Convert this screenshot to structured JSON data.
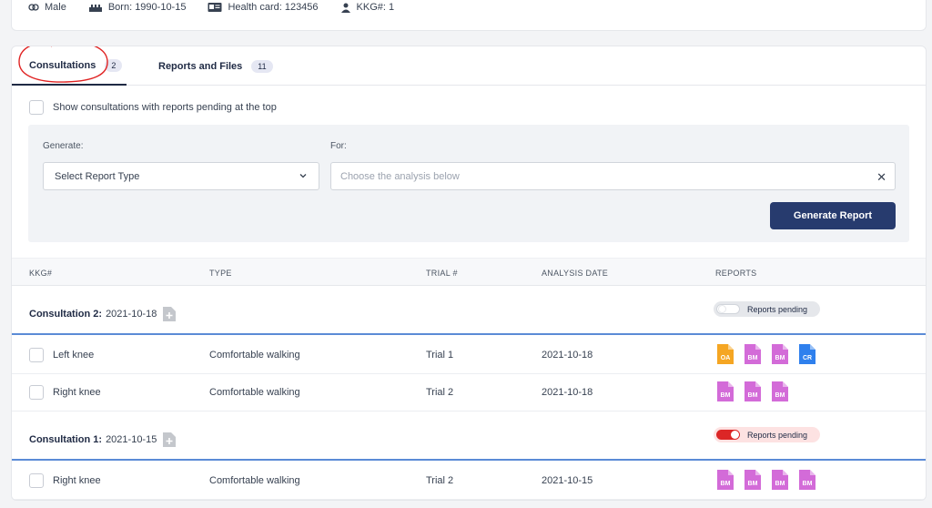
{
  "patient": {
    "gender": "Male",
    "born": "Born: 1990-10-15",
    "health_card": "Health card: 123456",
    "kkg": "KKG#: 1"
  },
  "tabs": [
    {
      "label": "Consultations",
      "count": "2",
      "active": true
    },
    {
      "label": "Reports and Files",
      "count": "11",
      "active": false
    }
  ],
  "pending_checkbox_label": "Show consultations with reports pending at the top",
  "generate": {
    "generate_label": "Generate:",
    "for_label": "For:",
    "select_placeholder": "Select Report Type",
    "for_placeholder": "Choose the analysis below",
    "button_label": "Generate Report"
  },
  "table": {
    "headers": [
      "KKG#",
      "TYPE",
      "TRIAL #",
      "ANALYSIS DATE",
      "REPORTS"
    ]
  },
  "consultations": [
    {
      "title": "Consultation 2:",
      "date": "2021-10-18",
      "pending_label": "Reports pending",
      "pending_on": false,
      "rows": [
        {
          "name": "Left knee",
          "type": "Comfortable walking",
          "trial": "Trial 1",
          "date": "2021-10-18",
          "reports": [
            "OA",
            "BM",
            "BM",
            "CR"
          ]
        },
        {
          "name": "Right knee",
          "type": "Comfortable walking",
          "trial": "Trial 2",
          "date": "2021-10-18",
          "reports": [
            "BM",
            "BM",
            "BM"
          ]
        }
      ]
    },
    {
      "title": "Consultation 1:",
      "date": "2021-10-15",
      "pending_label": "Reports pending",
      "pending_on": true,
      "rows": [
        {
          "name": "Right knee",
          "type": "Comfortable walking",
          "trial": "Trial 2",
          "date": "2021-10-15",
          "reports": [
            "BM",
            "BM",
            "BM",
            "BM"
          ]
        }
      ]
    }
  ],
  "colors": {
    "OA": "#f5a623",
    "BM": "#d36bd8",
    "CR": "#2f80ed",
    "accent": "#273b6e",
    "annotation": "#e02424"
  }
}
